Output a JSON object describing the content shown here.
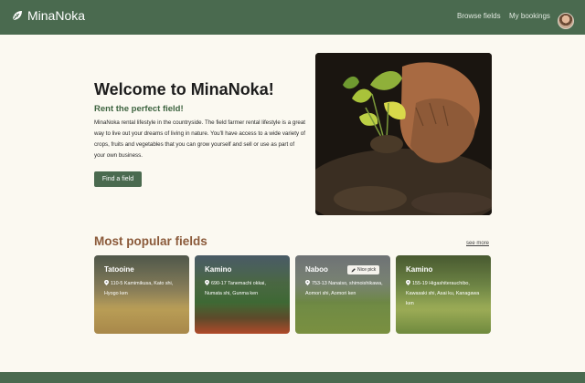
{
  "nav": {
    "brand": "MinaNoka",
    "links": [
      "Browse fields",
      "My bookings"
    ]
  },
  "hero": {
    "title": "Welcome to MinaNoka!",
    "subtitle": "Rent the perfect field!",
    "body": "MinaNoka rental lifestyle in the countryside. The field farmer rental lifestyle is a great way to live out your dreams of living in nature. You'll have access to a wide variety of crops, fruits and vegetables that you can grow yourself and sell or use as part of your own business.",
    "button": "Find a field"
  },
  "popular": {
    "title": "Most popular fields",
    "see_more": "see more",
    "cards": [
      {
        "name": "Tatooine",
        "location": "110-5 Kamimikusa, Kato shi, Hyogo ken"
      },
      {
        "name": "Kamino",
        "location": "690-17 Tanemachi okkai, Numata shi, Gunma ken"
      },
      {
        "name": "Naboo",
        "location": "753-13 Nanaiso, shimoishikawa, Aomori shi, Aomori ken",
        "badge": "Nice pick"
      },
      {
        "name": "Kamino",
        "location": "155-19 Higashiterauchibo, Kawasaki shi, Asai ku, Kanagawa ken"
      }
    ]
  },
  "icons": {
    "brand": "leaf-icon",
    "pin": "map-pin-icon",
    "badge": "pencil-icon"
  },
  "colors": {
    "primary": "#4a6a4f",
    "accent_brown": "#8b5a3a",
    "background": "#fbf9f1"
  }
}
